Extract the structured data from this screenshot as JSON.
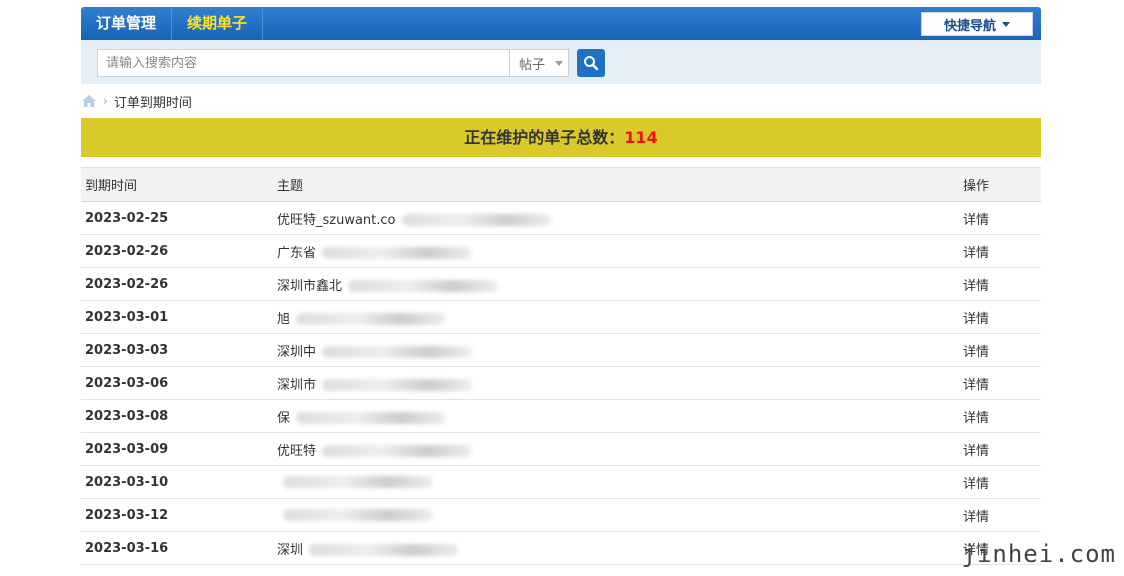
{
  "nav": {
    "items": [
      {
        "label": "订单管理",
        "active": false
      },
      {
        "label": "续期单子",
        "active": true
      }
    ],
    "quick_nav_label": "快捷导航"
  },
  "search": {
    "placeholder": "请输入搜索内容",
    "type_value": "帖子"
  },
  "breadcrumb": {
    "current": "订单到期时间"
  },
  "banner": {
    "text": "正在维护的单子总数：",
    "count": "114"
  },
  "table": {
    "headers": [
      "到期时间",
      "主题",
      "操作"
    ],
    "rows": [
      {
        "date": "2023-02-25",
        "subject": "优旺特_szuwant.co",
        "action": "详情"
      },
      {
        "date": "2023-02-26",
        "subject": "广东省",
        "action": "详情"
      },
      {
        "date": "2023-02-26",
        "subject": "深圳市鑫北",
        "action": "详情"
      },
      {
        "date": "2023-03-01",
        "subject": "旭",
        "action": "详情"
      },
      {
        "date": "2023-03-03",
        "subject": "深圳中",
        "action": "详情"
      },
      {
        "date": "2023-03-06",
        "subject": "深圳市",
        "action": "详情"
      },
      {
        "date": "2023-03-08",
        "subject": "保",
        "action": "详情"
      },
      {
        "date": "2023-03-09",
        "subject": "优旺特",
        "action": "详情"
      },
      {
        "date": "2023-03-10",
        "subject": "",
        "action": "详情"
      },
      {
        "date": "2023-03-12",
        "subject": "",
        "action": "详情"
      },
      {
        "date": "2023-03-16",
        "subject": "深圳",
        "action": "详情"
      }
    ]
  },
  "watermark": "jinhei.com"
}
